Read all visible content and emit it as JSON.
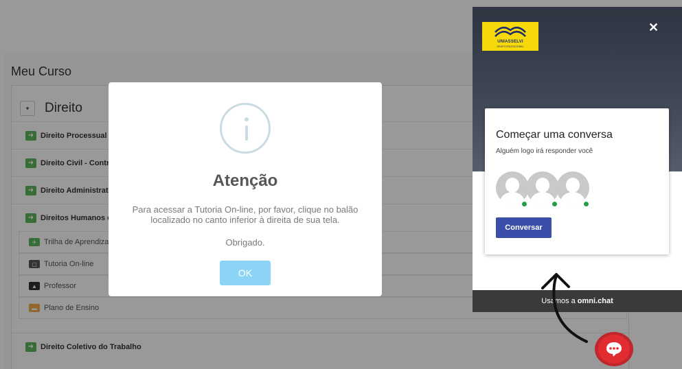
{
  "course": {
    "page_title": "Meu Curso",
    "section_toggle": "▾",
    "section_title": "Direito",
    "rows": [
      "Direito Processual P",
      "Direito Civil - Contra",
      "Direito Administrativ",
      "Direitos Humanos e"
    ],
    "subitems": [
      "Trilha de Aprendizag",
      "Tutoria On-line",
      "Professor",
      "Plano de Ensino"
    ],
    "bottom_row": "Direito Coletivo do Trabalho"
  },
  "dialog": {
    "title": "Atenção",
    "message": "Para acessar a Tutoria On-line, por favor, clique no balão localizado no canto inferior à direita de sua tela.",
    "thanks": "Obrigado.",
    "ok_label": "OK"
  },
  "chat": {
    "logo_name": "UNIASSELVI",
    "logo_tag": "GRUPO EDUCACIONAL",
    "close_label": "✕",
    "card_title": "Começar uma conversa",
    "card_subtitle": "Alguém logo irá responder você",
    "button_label": "Conversar",
    "footer_prefix": "Usamos a",
    "footer_brand": "omni.chat"
  },
  "colors": {
    "brand_yellow": "#f5d90a",
    "button_blue": "#3a4eaa",
    "ok_blue": "#8cd4f5",
    "launcher_red": "#e12c32",
    "online_green": "#24a148"
  },
  "icons": {
    "close": "close-icon",
    "info": "info-icon",
    "launcher": "chat-bubble-icon",
    "row": "arrow-right-icon"
  }
}
